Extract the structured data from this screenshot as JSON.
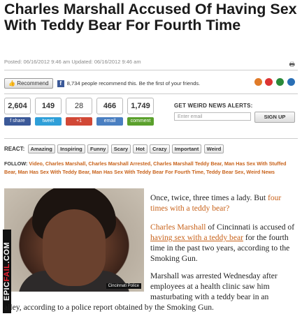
{
  "article": {
    "headline": "Charles Marshall Accused Of Having Sex With Teddy Bear For Fourth Time",
    "meta": "Posted: 06/16/2012 9:46 am Updated: 06/16/2012 9:46 am"
  },
  "recommend": {
    "button_label": "Recommend",
    "fb_text": "8,734 people recommend this. Be the first of your friends."
  },
  "share_counts": {
    "facebook": "2,604",
    "twitter": "149",
    "google": "28",
    "email": "466",
    "comment": "1,749"
  },
  "share_buttons": {
    "share": "f  share",
    "tweet": "tweet",
    "gplus": "+1",
    "email": "email",
    "comment": "comment"
  },
  "alerts": {
    "title": "GET WEIRD NEWS ALERTS:",
    "placeholder": "Enter email",
    "signup": "SIGN UP"
  },
  "react": {
    "label": "REACT:",
    "buttons": [
      "Amazing",
      "Inspiring",
      "Funny",
      "Scary",
      "Hot",
      "Crazy",
      "Important",
      "Weird"
    ]
  },
  "follow": {
    "label": "FOLLOW:",
    "tags": "Video, Charles Marshall, Charles Marshall Arrested, Charles Marshall Teddy Bear, Man Has Sex With Stuffed Bear, Man Has Sex With Teddy Bear, Man Has Sex With Teddy Bear For Fourth Time, Teddy Bear Sex, Weird News"
  },
  "photo": {
    "caption": "Cincinnati Police"
  },
  "watermark": {
    "part1": "EPIC",
    "part2": "FAIL",
    "part3": ".COM"
  },
  "body": {
    "p1_plain": "Once, twice, three times a lady. But ",
    "p1_link": "four times with a teddy bear?",
    "p2_name": "Charles Marshall",
    "p2_a": " of Cincinnati is accused of ",
    "p2_link": "having sex with a teddy bear",
    "p2_b": " for the fourth time in the past two years, according to the Smoking Gun.",
    "p3_a": "Marshall was arrested Wednesday after employees at a health clinic saw him masturbating with a teddy bear in an",
    "p3_b": "alley, according to a police report obtained by the Smoking Gun."
  }
}
